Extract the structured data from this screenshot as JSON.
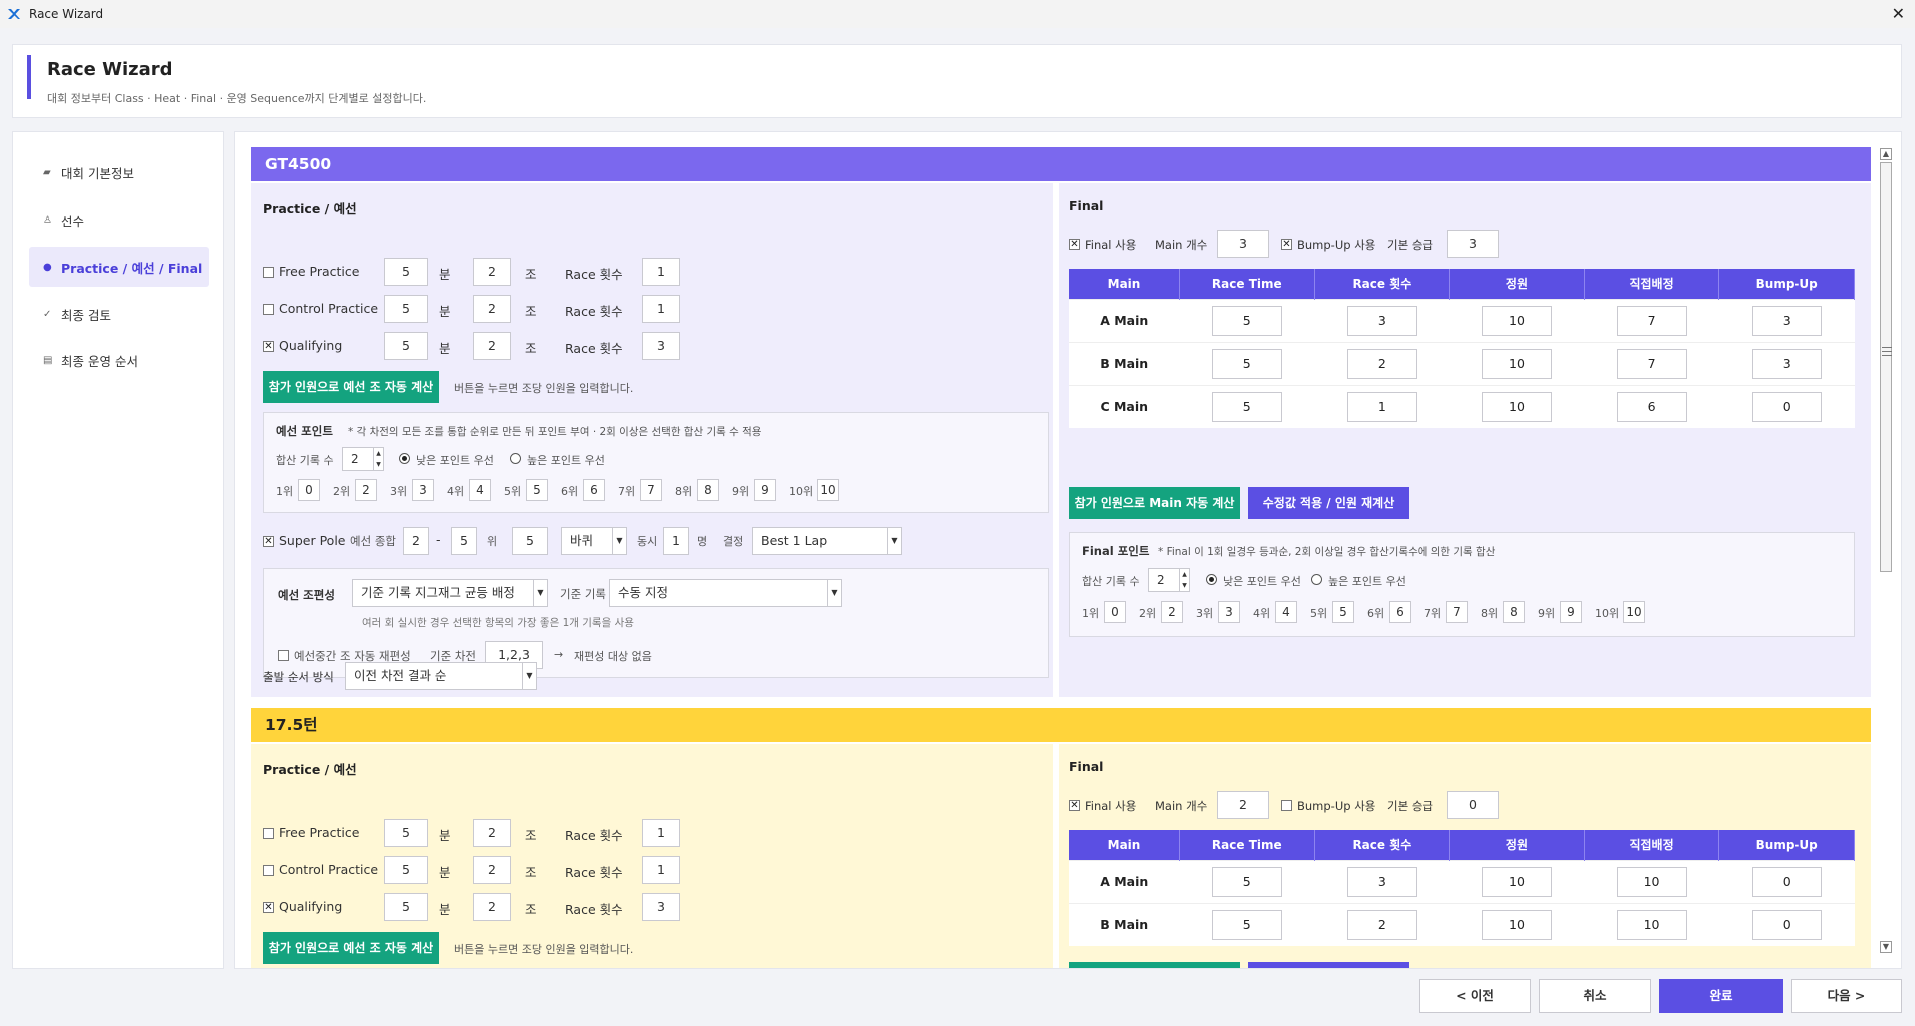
{
  "window": {
    "title": "Race Wizard"
  },
  "header": {
    "title": "Race Wizard",
    "subtitle": "대회 정보부터 Class · Heat · Final · 운영 Sequence까지 단계별로 설정합니다."
  },
  "sidebar": {
    "items": [
      {
        "label": "대회 기본정보",
        "icon": "flag-icon"
      },
      {
        "label": "선수",
        "icon": "person-icon"
      },
      {
        "label": "Practice / 예선 / Final",
        "icon": "info-icon",
        "active": true
      },
      {
        "label": "최종 검토",
        "icon": "check-icon"
      },
      {
        "label": "최종 운영 순서",
        "icon": "list-icon"
      }
    ]
  },
  "labels": {
    "practice_title": "Practice / 예선",
    "final_title": "Final",
    "free_practice": "Free Practice",
    "control_practice": "Control Practice",
    "qualifying": "Qualifying",
    "min": "분",
    "group": "조",
    "race_count": "Race 횟수",
    "auto_calc_btn": "참가 인원으로 예선 조 자동 계산",
    "auto_calc_hint": "버튼을 누르면 조당 인원을 입력합니다.",
    "qual_points": "예선 포인트",
    "qual_points_note": "* 각 차전의 모든 조를 통합 순위로 만든 뒤 포인트 부여 · 2회 이상은 선택한 합산 기록 수 적용",
    "sum_count": "합산 기록 수",
    "low_first": "낮은 포인트 우선",
    "high_first": "높은 포인트 우선",
    "super_pole": "Super Pole",
    "qual_total": "예선 종합",
    "dash": "-",
    "rank": "위",
    "tie": "동시",
    "person": "명",
    "decide": "결정",
    "qual_group": "예선 조편성",
    "base_record": "기준 기록",
    "group_hint": "여러 회 실시한 경우 선택한 항목의 가장 좋은 1개 기록을 사용",
    "auto_regroup": "예선중간 조 자동 재편성",
    "base_round": "기준 차전",
    "arrow": "→",
    "no_regroup": "재편성 대상 없음",
    "start_order": "출발 순서 방식",
    "final_use": "Final 사용",
    "main_count": "Main 개수",
    "bump_use": "Bump-Up 사용",
    "base_promote": "기본 승급",
    "main_auto_btn": "참가 인원으로 Main 자동 계산",
    "apply_btn": "수정값 적용 / 인원 재계산",
    "final_points": "Final 포인트",
    "final_points_note": "* Final 이 1회 일경우 등과순, 2회 이상일 경우 합산기록수에 의한 기록 합산"
  },
  "table_headers": [
    "Main",
    "Race Time",
    "Race 횟수",
    "정원",
    "직접배정",
    "Bump-Up"
  ],
  "ranks": [
    "1위",
    "2위",
    "3위",
    "4위",
    "5위",
    "6위",
    "7위",
    "8위",
    "9위",
    "10위"
  ],
  "classes": [
    {
      "name": "GT4500",
      "color": "#7b68ee",
      "practice": [
        {
          "checked": false,
          "min": "5",
          "group": "2",
          "races": "1"
        },
        {
          "checked": false,
          "min": "5",
          "group": "2",
          "races": "1"
        },
        {
          "checked": true,
          "min": "5",
          "group": "2",
          "races": "3"
        }
      ],
      "sum_count": "2",
      "points": [
        "0",
        "2",
        "3",
        "4",
        "5",
        "6",
        "7",
        "8",
        "9",
        "10"
      ],
      "super_pole": {
        "from": "2",
        "to": "5",
        "rank": "5",
        "unit": "바퀴",
        "tie": "1",
        "decide": "Best 1 Lap"
      },
      "group_method": "기준 기록 지그재그 균등 배정",
      "base_record": "수동 지정",
      "base_round": "1,2,3",
      "start_order": "이전 차전 결과 순",
      "final": {
        "main_count": "3",
        "bump": true,
        "promote": "3",
        "rows": [
          {
            "main": "A Main",
            "time": "5",
            "races": "3",
            "cap": "10",
            "direct": "7",
            "bump": "3"
          },
          {
            "main": "B Main",
            "time": "5",
            "races": "2",
            "cap": "10",
            "direct": "7",
            "bump": "3"
          },
          {
            "main": "C Main",
            "time": "5",
            "races": "1",
            "cap": "10",
            "direct": "6",
            "bump": "0"
          }
        ],
        "sum_count": "2",
        "points": [
          "0",
          "2",
          "3",
          "4",
          "5",
          "6",
          "7",
          "8",
          "9",
          "10"
        ]
      }
    },
    {
      "name": "17.5턴",
      "color": "#ffd43b",
      "practice": [
        {
          "checked": false,
          "min": "5",
          "group": "2",
          "races": "1"
        },
        {
          "checked": false,
          "min": "5",
          "group": "2",
          "races": "1"
        },
        {
          "checked": true,
          "min": "5",
          "group": "2",
          "races": "3"
        }
      ],
      "final": {
        "main_count": "2",
        "bump": false,
        "promote": "0",
        "rows": [
          {
            "main": "A Main",
            "time": "5",
            "races": "3",
            "cap": "10",
            "direct": "10",
            "bump": "0"
          },
          {
            "main": "B Main",
            "time": "5",
            "races": "2",
            "cap": "10",
            "direct": "10",
            "bump": "0"
          }
        ]
      }
    }
  ],
  "footer": {
    "prev": "< 이전",
    "cancel": "취소",
    "finish": "완료",
    "next": "다음 >"
  }
}
